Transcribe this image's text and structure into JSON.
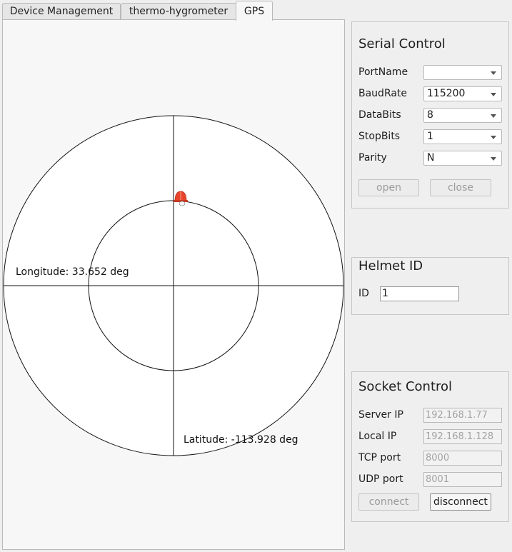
{
  "tabs": [
    {
      "label": "Device Management"
    },
    {
      "label": "thermo-hygrometer"
    },
    {
      "label": "GPS"
    }
  ],
  "gps": {
    "longitude_text": "Longitude: 33.652 deg",
    "latitude_text": "Latitude: -113.928 deg",
    "marker_icon": "helmet-icon",
    "marker_color": "#e8452c"
  },
  "serial": {
    "title": "Serial Control",
    "fields": [
      {
        "label": "PortName",
        "value": ""
      },
      {
        "label": "BaudRate",
        "value": "115200"
      },
      {
        "label": "DataBits",
        "value": "8"
      },
      {
        "label": "StopBits",
        "value": "1"
      },
      {
        "label": "Parity",
        "value": "N"
      }
    ],
    "open_label": "open",
    "close_label": "close"
  },
  "helmet": {
    "title": "Helmet ID",
    "id_label": "ID",
    "id_value": "1"
  },
  "socket": {
    "title": "Socket Control",
    "fields": [
      {
        "label": "Server IP",
        "placeholder": "192.168.1.77"
      },
      {
        "label": "Local IP",
        "placeholder": "192.168.1.128"
      },
      {
        "label": "TCP port",
        "placeholder": "8000"
      },
      {
        "label": "UDP port",
        "placeholder": "8001"
      }
    ],
    "connect_label": "connect",
    "disconnect_label": "disconnect"
  }
}
